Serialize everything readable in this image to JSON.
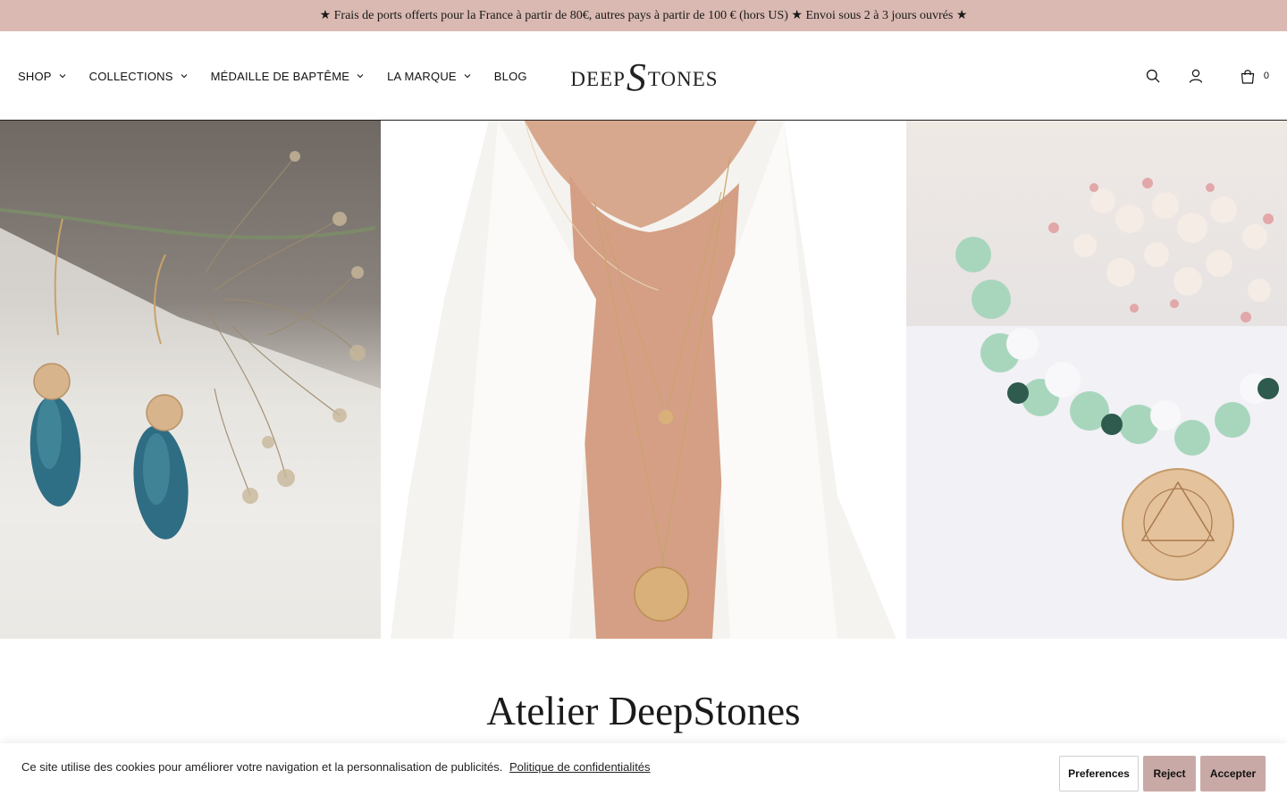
{
  "announcement": "★ Frais de ports offerts pour la France à partir de 80€, autres pays à partir de 100 € (hors US) ★ Envoi sous 2 à 3 jours ouvrés ★",
  "nav": {
    "items": [
      {
        "label": "SHOP",
        "has_dropdown": true
      },
      {
        "label": "COLLECTIONS",
        "has_dropdown": true
      },
      {
        "label": "MÉDAILLE DE BAPTÊME",
        "has_dropdown": true
      },
      {
        "label": "LA MARQUE",
        "has_dropdown": true
      },
      {
        "label": "BLOG",
        "has_dropdown": false
      }
    ]
  },
  "logo": {
    "part1": "DEEP",
    "s": "S",
    "part2": "TONES"
  },
  "header_icons": {
    "search": "search-icon",
    "account": "user-icon",
    "cart": "shopping-bag-icon"
  },
  "cart": {
    "count": "0"
  },
  "hero": {
    "panels": [
      {
        "subject": "earrings-with-dried-flowers"
      },
      {
        "subject": "necklaces-on-white-shirt"
      },
      {
        "subject": "bracelet-with-chakra-medal"
      }
    ]
  },
  "section": {
    "title": "Atelier DeepStones"
  },
  "cookie": {
    "text": "Ce site utilise des cookies pour améliorer votre navigation et la personnalisation de publicités.",
    "link": "Politique de confidentialités",
    "buttons": {
      "preferences": "Preferences",
      "reject": "Reject",
      "accept": "Accepter"
    }
  },
  "colors": {
    "announce_bg": "#d9b9b1",
    "button_accent": "#c9a9a6"
  }
}
